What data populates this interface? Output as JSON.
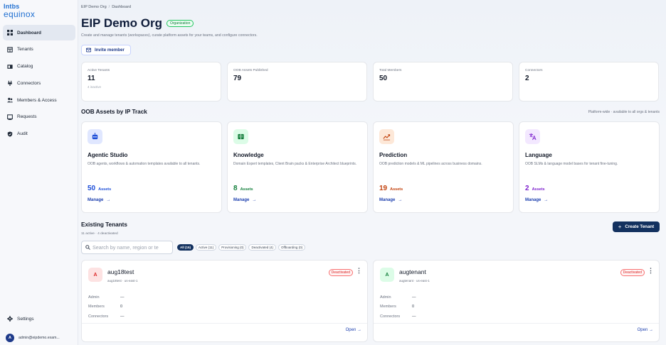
{
  "brand": {
    "line1": "Intbs",
    "line2": "equinox"
  },
  "sidebar": {
    "items": [
      {
        "label": "Dashboard",
        "icon": "grid-icon",
        "active": true
      },
      {
        "label": "Tenants",
        "icon": "building-icon"
      },
      {
        "label": "Catalog",
        "icon": "book-icon"
      },
      {
        "label": "Connectors",
        "icon": "plug-icon"
      },
      {
        "label": "Members & Access",
        "icon": "users-icon"
      },
      {
        "label": "Requests",
        "icon": "inbox-icon"
      },
      {
        "label": "Audit",
        "icon": "shield-icon"
      }
    ],
    "settings_label": "Settings",
    "user_initial": "A",
    "user_email": "admin@eipdemo.exam..."
  },
  "breadcrumb": {
    "org": "EIP Demo Org",
    "sep": "/",
    "page": "Dashboard"
  },
  "header": {
    "title": "EIP Demo Org",
    "badge": "Organization",
    "subtitle": "Create and manage tenants (workspaces), curate platform assets for your teams, and configure connectors.",
    "invite_label": "Invite member"
  },
  "stats": [
    {
      "label": "Active Tenants",
      "value": "11",
      "sub": "4 inactive"
    },
    {
      "label": "OOB Assets Published",
      "value": "79",
      "sub": ""
    },
    {
      "label": "Total Members",
      "value": "50",
      "sub": ""
    },
    {
      "label": "Connectors",
      "value": "2",
      "sub": ""
    }
  ],
  "tracks_section": {
    "title": "OOB Assets by IP Track",
    "note": "Platform-wide · available to all orgs & tenants"
  },
  "tracks": [
    {
      "name": "Agentic Studio",
      "desc": "OOB agents, workflows & automation templates available to all tenants.",
      "count": "50",
      "unit": "Assets",
      "manage": "Manage",
      "color": "#1d4ed8",
      "bg": "#e0e7ff",
      "icon": "robot-icon"
    },
    {
      "name": "Knowledge",
      "desc": "Domain Expert templates, Client Brain packs & Enterprise Architect blueprints.",
      "count": "8",
      "unit": "Assets",
      "manage": "Manage",
      "color": "#15803d",
      "bg": "#dcfce7",
      "icon": "book-open-icon"
    },
    {
      "name": "Prediction",
      "desc": "OOB prediction models & ML pipelines across business domains.",
      "count": "19",
      "unit": "Assets",
      "manage": "Manage",
      "color": "#c2410c",
      "bg": "#fde8d8",
      "icon": "trend-icon"
    },
    {
      "name": "Language",
      "desc": "OOB SLMs & language model bases for tenant fine-tuning.",
      "count": "2",
      "unit": "Assets",
      "manage": "Manage",
      "color": "#7e22ce",
      "bg": "#f3e8ff",
      "icon": "translate-icon"
    }
  ],
  "tenants_section": {
    "title": "Existing Tenants",
    "sub": "11 active · 4 deactivated",
    "create_label": "Create Tenant",
    "search_placeholder": "Search by name, region or te",
    "filters": [
      {
        "label": "All (15)",
        "active": true
      },
      {
        "label": "Active (11)"
      },
      {
        "label": "Provisioning (0)"
      },
      {
        "label": "Deactivated (4)"
      },
      {
        "label": "Offboarding (0)"
      }
    ]
  },
  "tenants": [
    {
      "initial": "A",
      "name": "aug18test",
      "meta": "aug18test · us-east-1",
      "status": "Deactivated",
      "admin_label": "Admin",
      "admin": "—",
      "members_label": "Members",
      "members": "0",
      "connectors_label": "Connectors",
      "connectors": "—",
      "open_label": "Open →",
      "av_bg": "#fde2e2",
      "av_color": "#dc2626"
    },
    {
      "initial": "A",
      "name": "augtenant",
      "meta": "augtenant · us-east-1",
      "status": "Deactivated",
      "admin_label": "Admin",
      "admin": "—",
      "members_label": "Members",
      "members": "0",
      "connectors_label": "Connectors",
      "connectors": "—",
      "open_label": "Open →",
      "av_bg": "#dcfce7",
      "av_color": "#15803d"
    }
  ]
}
